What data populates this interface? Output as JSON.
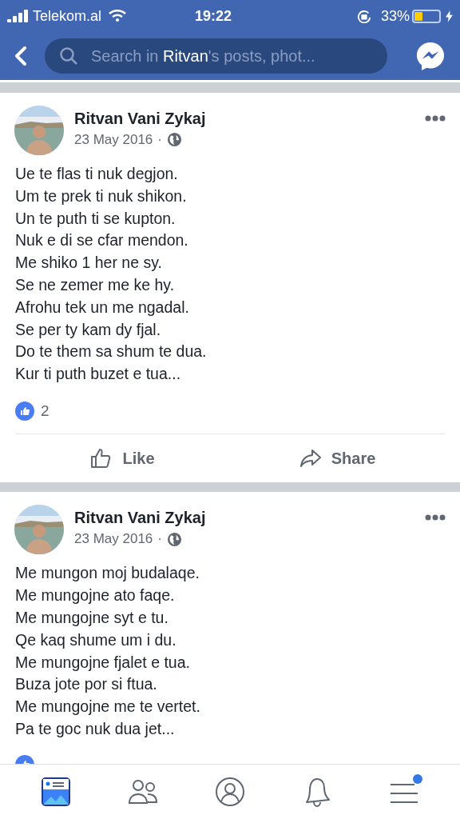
{
  "status_bar": {
    "carrier": "Telekom.al",
    "time": "19:22",
    "battery": "33%"
  },
  "header": {
    "search": {
      "placeholder": "Search in **Ritvan**'s posts, phot..."
    }
  },
  "posts": [
    {
      "author": "Ritvan Vani Zykaj",
      "date": "23 May 2016",
      "separator": "·",
      "lines": [
        "Ue te flas ti nuk degjon.",
        "Um te prek ti nuk shikon.",
        "Un te puth ti se kupton.",
        "Nuk e di se cfar mendon.",
        "Me shiko 1 her ne sy.",
        "Se ne zemer me ke hy.",
        "Afrohu tek un me ngadal.",
        "Se per ty kam dy fjal.",
        "Do te them sa shum te dua.",
        "Kur ti puth buzet e tua..."
      ],
      "likes": "2",
      "actions": [
        "Like",
        "Share"
      ]
    },
    {
      "author": "Ritvan Vani Zykaj",
      "date": "23 May 2016",
      "separator": "·",
      "lines": [
        "Me mungon moj budalaqe.",
        "Me mungojne ato faqe.",
        "Me mungojne syt e tu.",
        "Qe kaq shume um i du.",
        "Me mungojne fjalet e tua.",
        "Buza jote por si ftua.",
        "Me mungojne me te vertet.",
        "Pa te goc nuk dua jet..."
      ]
    }
  ],
  "tab_bar": [
    {
      "kind": "feed",
      "selected": true,
      "badge": false
    },
    {
      "kind": "friends",
      "selected": false,
      "badge": false
    },
    {
      "kind": "profile",
      "selected": false,
      "badge": false
    },
    {
      "kind": "notifications",
      "selected": false,
      "badge": false
    },
    {
      "kind": "menu",
      "selected": false,
      "badge": true
    }
  ]
}
